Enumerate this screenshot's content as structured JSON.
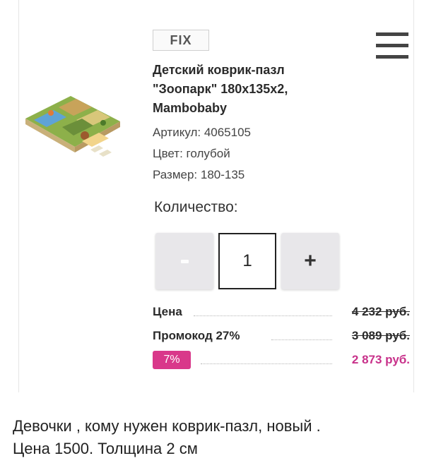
{
  "badge": {
    "label": "FIX"
  },
  "product": {
    "title_line1": "Детский коврик-пазл",
    "title_line2": "\"Зоопарк\" 180x135x2,",
    "title_line3": "Mambobaby",
    "article": "Артикул: 4065105",
    "color": "Цвет: голубой",
    "size": "Размер: 180-135",
    "image_icon": "puzzle-mat-image"
  },
  "quantity": {
    "label": "Количество:",
    "minus_label": "-",
    "plus_label": "+",
    "value": "1"
  },
  "pricing": {
    "price_label": "Цена",
    "price_value": "4 232 руб.",
    "promo_label": "Промокод 27%",
    "promo_value": "3 089 руб.",
    "discount_badge": "7%",
    "final_value": "2 873 руб.",
    "accent_color": "#d9388a"
  },
  "caption": {
    "line1": "Девочки , кому нужен коврик-пазл, новый .",
    "line2": "Цена 1500. Толщина 2 см"
  }
}
